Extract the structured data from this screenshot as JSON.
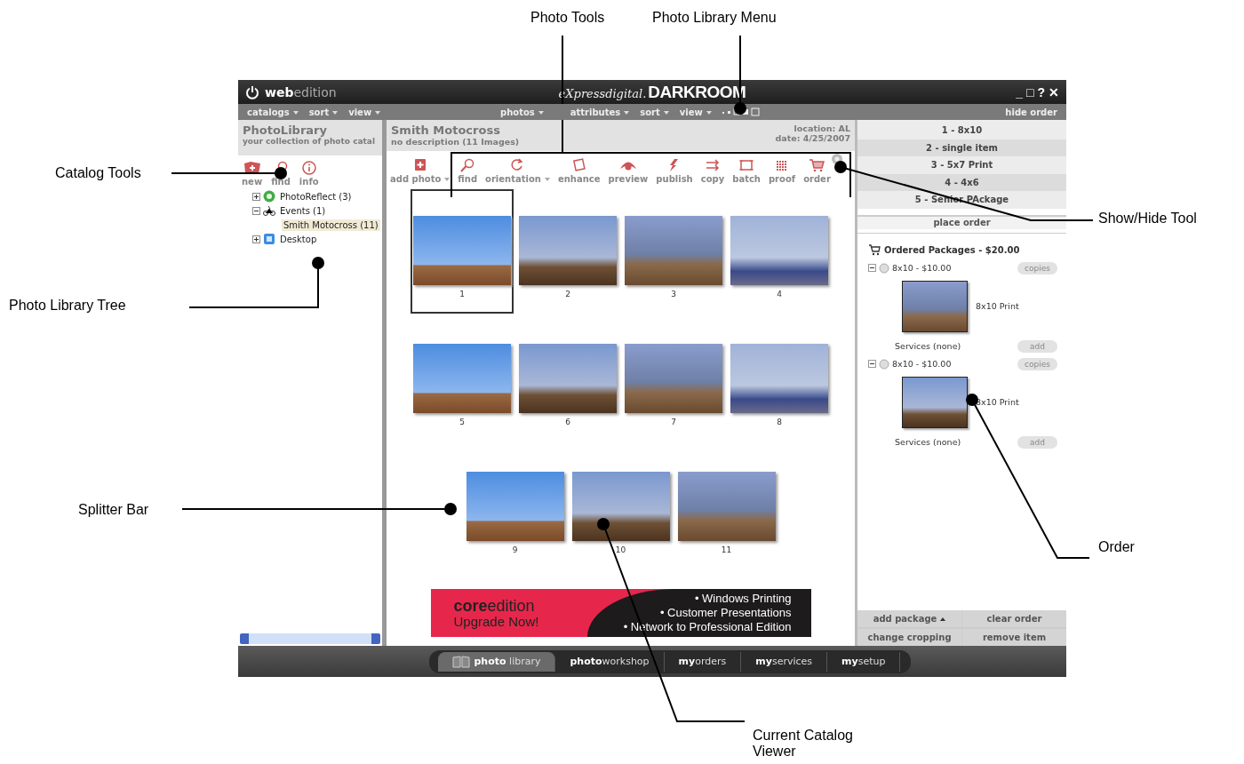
{
  "callouts": [
    {
      "label": "Photo Tools"
    },
    {
      "label": "Photo Library Menu"
    },
    {
      "label": "Catalog Tools"
    },
    {
      "label": "Show/Hide Tool"
    },
    {
      "label": "Photo Library Tree"
    },
    {
      "label": "Splitter Bar"
    },
    {
      "label": "Order"
    },
    {
      "label": "Current Catalog Viewer"
    }
  ],
  "title_bar": {
    "brand": "**web**edition",
    "logo_small": "eXpressdigital.",
    "logo_big": "DARKROOM",
    "window_controls": [
      "_",
      "□",
      "?",
      "✕"
    ]
  },
  "menu_bar": {
    "left": [
      {
        "label": "catalogs"
      },
      {
        "label": "sort"
      },
      {
        "label": "view"
      }
    ],
    "center": [
      {
        "label": "photos"
      },
      {
        "label": "attributes"
      },
      {
        "label": "sort"
      },
      {
        "label": "view"
      }
    ],
    "right": "hide order"
  },
  "library": {
    "title": "PhotoLibrary",
    "subtitle": "your collection of photo catal",
    "tools": [
      {
        "label": "new"
      },
      {
        "label": "find"
      },
      {
        "label": "info"
      }
    ],
    "tree": [
      {
        "label": "PhotoReflect (3)",
        "expanded": false,
        "selected": false
      },
      {
        "label": "Events (1)",
        "expanded": true,
        "selected": false,
        "children": [
          {
            "label": "Smith Motocross (11)",
            "selected": true
          }
        ]
      },
      {
        "label": "Desktop",
        "expanded": false,
        "selected": false
      }
    ]
  },
  "catalog": {
    "title": "Smith Motocross",
    "description": "no description (11 Images)",
    "location": "location: AL",
    "date": "date: 4/25/2007",
    "tools": [
      {
        "label": "add photo",
        "dropdown": true
      },
      {
        "label": "find",
        "dropdown": false
      },
      {
        "label": "orientation",
        "dropdown": true
      },
      {
        "label": "enhance",
        "dropdown": false
      },
      {
        "label": "preview",
        "dropdown": false
      },
      {
        "label": "publish",
        "dropdown": false
      },
      {
        "label": "copy",
        "dropdown": false
      },
      {
        "label": "batch",
        "dropdown": false
      },
      {
        "label": "proof",
        "dropdown": false
      },
      {
        "label": "order",
        "dropdown": false
      }
    ],
    "photos": [
      {
        "number": "1",
        "selected": true
      },
      {
        "number": "2",
        "selected": false
      },
      {
        "number": "3",
        "selected": false
      },
      {
        "number": "4",
        "selected": false
      },
      {
        "number": "5",
        "selected": false
      },
      {
        "number": "6",
        "selected": false
      },
      {
        "number": "7",
        "selected": false
      },
      {
        "number": "8",
        "selected": false
      },
      {
        "number": "9",
        "selected": false
      },
      {
        "number": "10",
        "selected": false
      },
      {
        "number": "11",
        "selected": false
      }
    ],
    "ad": {
      "brand": "**core**edition",
      "cta": "Upgrade Now!",
      "bullets": [
        "• Windows Printing",
        "• Customer Presentations",
        "• Network to Professional Edition"
      ]
    }
  },
  "order": {
    "packages": [
      {
        "label": "1 - 8x10"
      },
      {
        "label": "2 - single item"
      },
      {
        "label": "3 - 5x7 Print"
      },
      {
        "label": "4 - 4x6"
      },
      {
        "label": "5 - Senior PAckage"
      }
    ],
    "place_order": "place order",
    "title": "Ordered Packages - $20.00",
    "items": [
      {
        "label": "8x10 - $10.00",
        "copies": "copies",
        "print": "8x10 Print",
        "services": "Services (none)",
        "add": "add"
      },
      {
        "label": "8x10 - $10.00",
        "copies": "copies",
        "print": "8x10 Print",
        "services": "Services (none)",
        "add": "add"
      }
    ],
    "buttons": [
      {
        "label": "add package",
        "caret": true
      },
      {
        "label": "clear order",
        "caret": false
      },
      {
        "label": "change cropping",
        "caret": false
      },
      {
        "label": "remove item",
        "caret": false
      }
    ]
  },
  "nav": {
    "tabs": [
      {
        "label": "**photo** library",
        "selected": true
      },
      {
        "label": "**photo**workshop",
        "selected": false
      },
      {
        "label": "**my**orders",
        "selected": false
      },
      {
        "label": "**my**services",
        "selected": false
      },
      {
        "label": "**my**setup",
        "selected": false
      }
    ]
  }
}
